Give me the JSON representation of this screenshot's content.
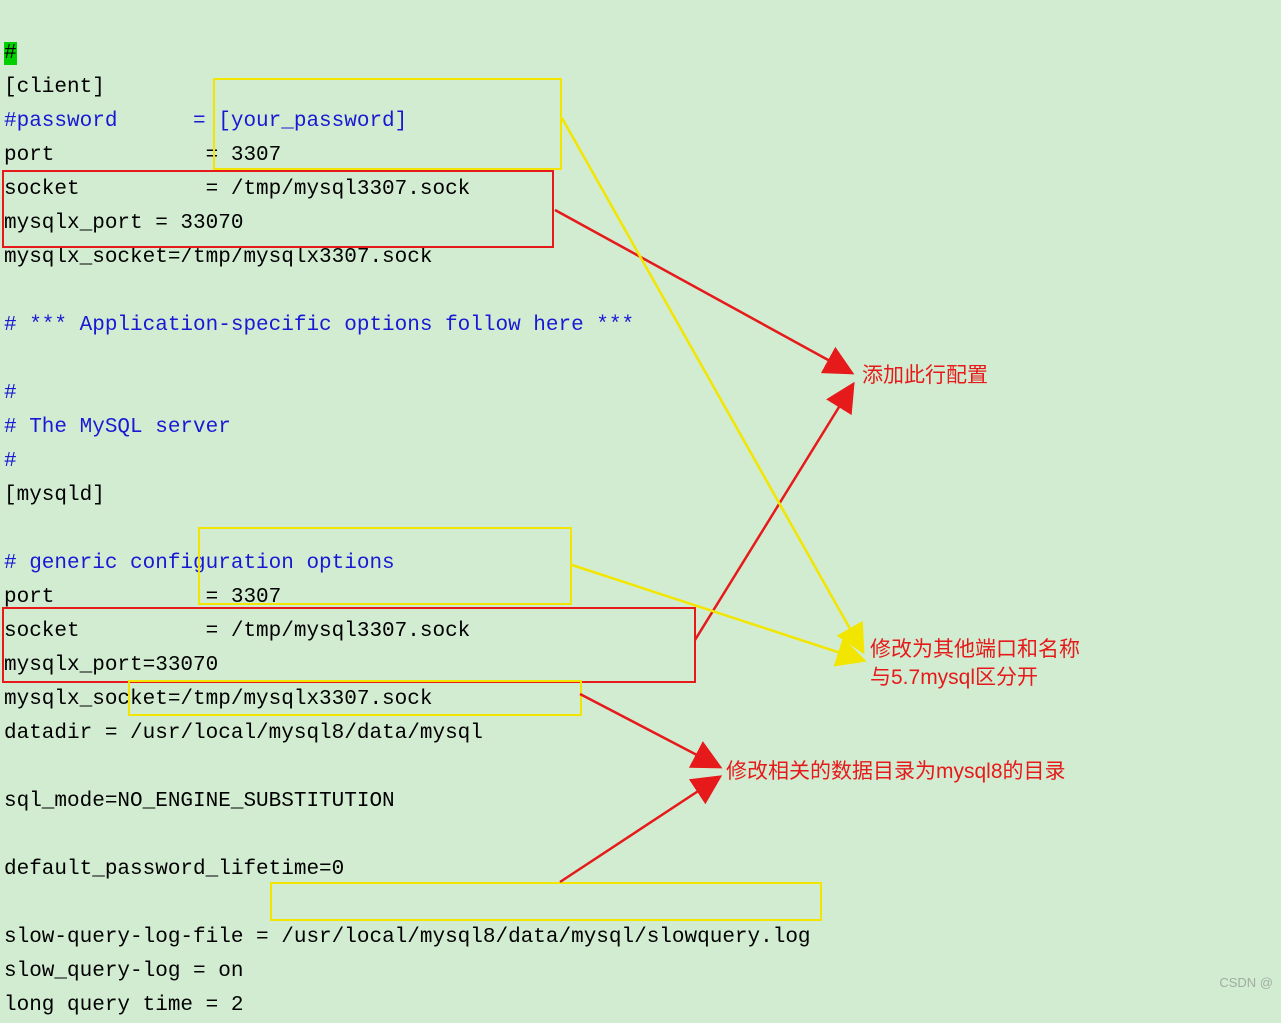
{
  "lines": {
    "l1": "#",
    "l2": "[client]",
    "l3a": "#password      = [your_password]",
    "l4": "port            = 3307",
    "l5": "socket          = /tmp/mysql3307.sock",
    "l6": "mysqlx_port = 33070",
    "l7": "mysqlx_socket=/tmp/mysqlx3307.sock",
    "l8": "",
    "l9": "# *** Application-specific options follow here ***",
    "l10": "",
    "l11": "#",
    "l12": "# The MySQL server",
    "l13": "#",
    "l14": "[mysqld]",
    "l15": "",
    "l16": "# generic configuration options",
    "l17": "port            = 3307",
    "l18": "socket          = /tmp/mysql3307.sock",
    "l19": "mysqlx_port=33070",
    "l20": "mysqlx_socket=/tmp/mysqlx3307.sock",
    "l21a": "datadir = ",
    "l21b": "/usr/local/mysql8/data/mysql",
    "l22": "",
    "l23": "sql_mode=NO_ENGINE_SUBSTITUTION",
    "l24": "",
    "l25": "default_password_lifetime=0",
    "l26": "",
    "l27a": "slow-query-log-file = ",
    "l27b": "/usr/local/mysql8/data/mysql/slowquery.log",
    "l28": "slow_query-log = on",
    "l29": "long query time = 2"
  },
  "annotations": {
    "add_line": "添加此行配置",
    "change_port_1": "修改为其他端口和名称",
    "change_port_2": "与5.7mysql区分开",
    "change_dir": "修改相关的数据目录为mysql8的目录"
  },
  "watermark": "CSDN @"
}
